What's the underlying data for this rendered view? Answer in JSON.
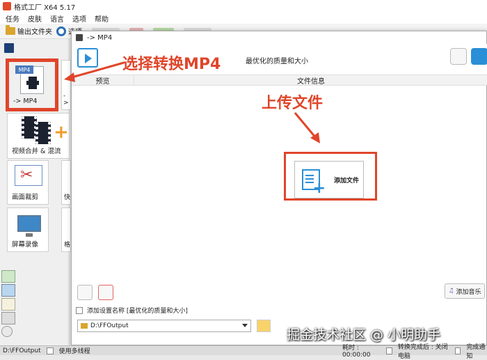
{
  "window": {
    "title": "格式工厂 X64 5.17"
  },
  "menu": {
    "items": [
      "任务",
      "皮肤",
      "语言",
      "选项",
      "帮助"
    ]
  },
  "toolbar": {
    "output_folder": "输出文件夹",
    "options": "选项"
  },
  "tiles": {
    "mp4": {
      "badge": "MP4",
      "label": "-> MP4"
    },
    "merge": {
      "label": "视频合并 & 混流"
    },
    "crop": {
      "label": "画面裁剪"
    },
    "record": {
      "label": "屏幕录像"
    },
    "stub_arrow": "->",
    "stub_fast": "快",
    "stub_grid": "格"
  },
  "dialog": {
    "title": "-> MP4",
    "preset": "最优化的质量和大小",
    "columns": {
      "preview": "预览",
      "info": "文件信息"
    },
    "add_file": "添加文件",
    "add_music": "添加音乐",
    "setting_name_checkbox": "添加设置名称 [最优化的质量和大小]",
    "output_path": "D:\\FFOutput"
  },
  "annotations": {
    "select": "选择转换MP4",
    "upload": "上传文件",
    "watermark": "掘金技术社区 @ 小明助手"
  },
  "statusbar": {
    "path": "D:\\FFOutput",
    "multithread": "使用多线程",
    "elapsed": "耗时 : 00:00:00",
    "after_done": "转换完成后 : 关闭电脑",
    "notify": "完成通知"
  },
  "colors": {
    "accent_red": "#e0452a",
    "accent_blue": "#2a8fd6"
  }
}
